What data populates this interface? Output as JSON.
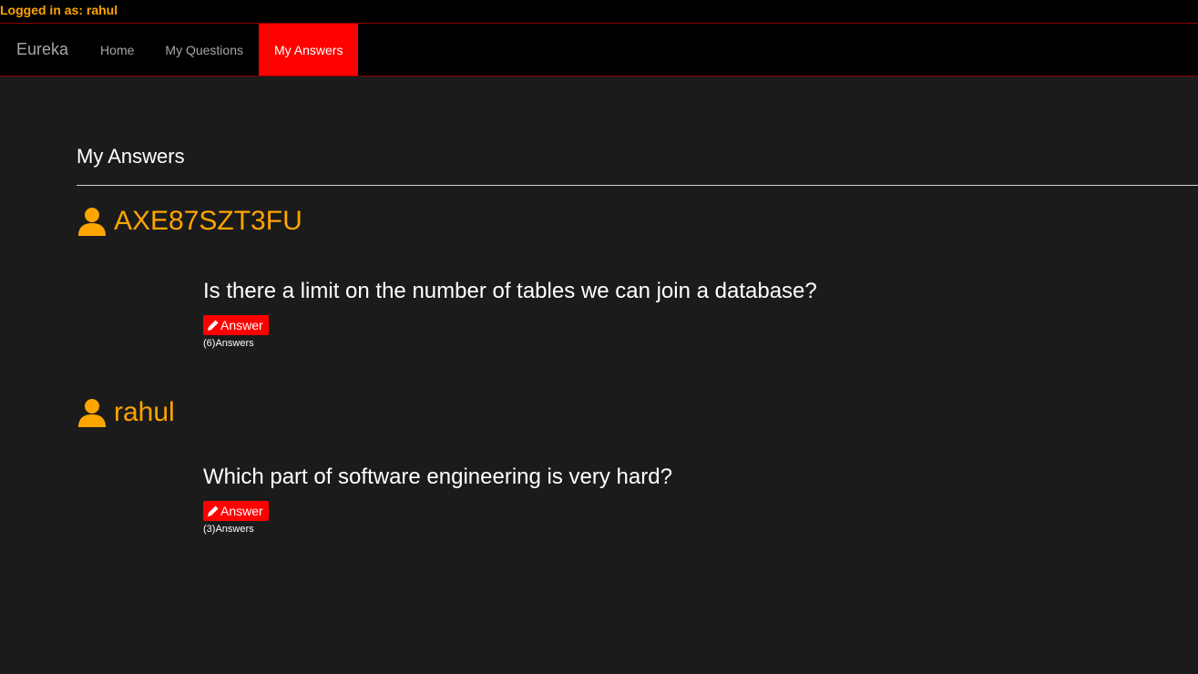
{
  "login": {
    "text": "Logged in as: rahul"
  },
  "nav": {
    "brand": "Eureka",
    "items": [
      {
        "label": "Home"
      },
      {
        "label": "My Questions"
      },
      {
        "label": "My Answers"
      }
    ]
  },
  "page": {
    "title": "My Answers"
  },
  "entries": [
    {
      "user": "AXE87SZT3FU",
      "question": "Is there a limit on the number of tables we can join a database?",
      "answer_label": "Answer",
      "answer_count": "(6)Answers"
    },
    {
      "user": "rahul",
      "question": "Which part of software engineering is very hard?",
      "answer_label": "Answer",
      "answer_count": "(3)Answers"
    }
  ],
  "colors": {
    "accent": "#ff0000",
    "username": "#ffa500",
    "background": "#1b1b1b",
    "nav_background": "#000000"
  },
  "icons": {
    "user": "user-icon",
    "pencil": "pencil-icon"
  }
}
